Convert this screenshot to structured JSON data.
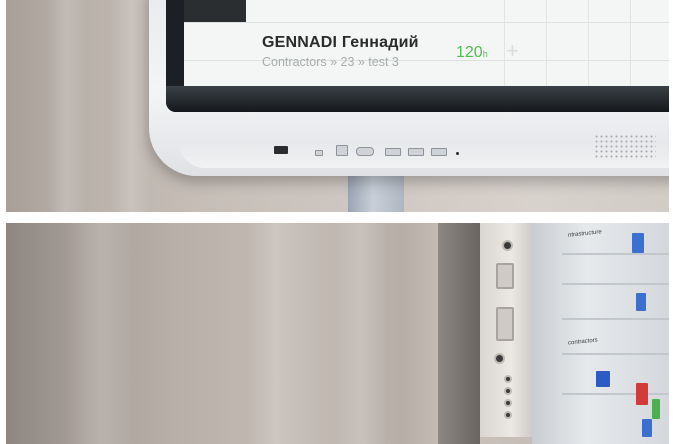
{
  "screen_card": {
    "name": "GENNADI Геннадий",
    "subtitle": "Contractors » 23 » test 3",
    "hours_value": "120",
    "hours_unit": "h"
  },
  "side_screen_labels": [
    "ntrastructure",
    "contractors"
  ],
  "colors": {
    "hours_green": "#4fbf4f",
    "bezel": "#eceef1",
    "screen_dark": "#1c2024"
  }
}
